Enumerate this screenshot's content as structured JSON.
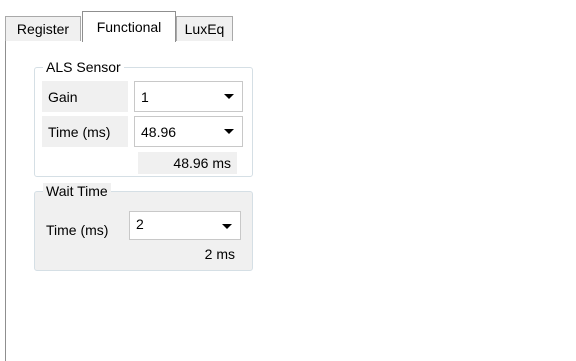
{
  "tabs": [
    {
      "label": "Register",
      "active": false
    },
    {
      "label": "Functional",
      "active": true
    },
    {
      "label": "LuxEq",
      "active": false
    }
  ],
  "als_sensor": {
    "title": "ALS Sensor",
    "gain_label": "Gain",
    "gain_value": "1",
    "time_label": "Time (ms)",
    "time_value": "48.96",
    "readout": "48.96 ms"
  },
  "wait_time": {
    "title": "Wait Time",
    "time_label": "Time (ms)",
    "time_value": "2",
    "readout": "2 ms"
  },
  "icons": {
    "dropdown": "chevron-down-icon"
  }
}
